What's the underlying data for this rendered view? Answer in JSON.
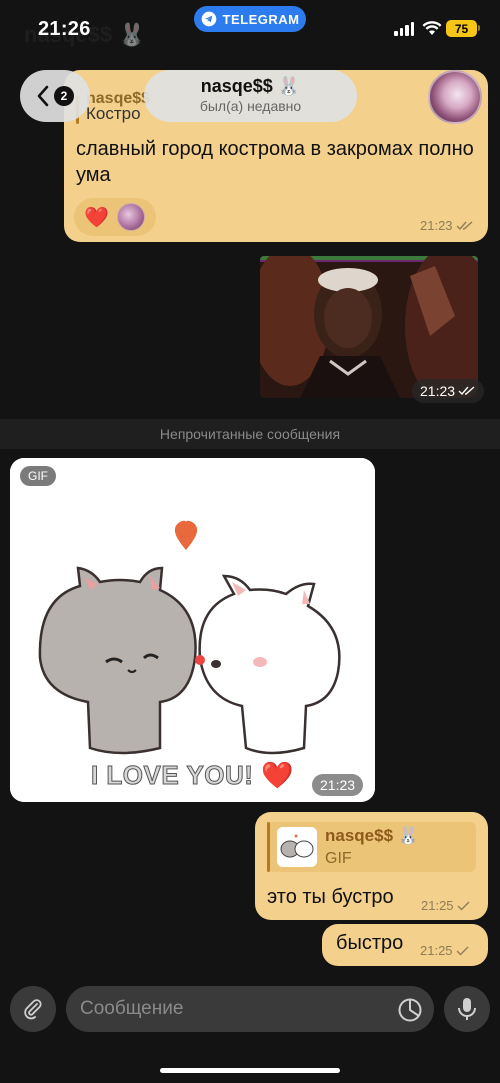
{
  "status_bar": {
    "time": "21:26",
    "app_pill": "TELEGRAM",
    "battery": "75"
  },
  "header": {
    "back_badge": "2",
    "contact_name": "nasqe$$ 🐰",
    "contact_status": "был(а) недавно"
  },
  "messages": {
    "top": {
      "reply_name": "nasqe$$",
      "reply_text": "Костро",
      "text": "славный город кострома в закромах полно ума",
      "reaction": "❤️",
      "time": "21:23"
    },
    "photo": {
      "time": "21:23"
    },
    "unread_divider": "Непрочитанные сообщения",
    "gif": {
      "tag": "GIF",
      "caption": "I LOVE YOU! ❤️",
      "time": "21:23"
    },
    "reply": {
      "quote_name": "nasqe$$ 🐰",
      "quote_type": "GIF",
      "text": "это ты бустро",
      "time": "21:25"
    },
    "short": {
      "text": "быстро",
      "time": "21:25"
    }
  },
  "input": {
    "placeholder": "Сообщение"
  },
  "colors": {
    "background": "#131313",
    "own_bubble": "#f3d08c",
    "telegram_blue": "#2c7cf0",
    "battery": "#f5c518"
  }
}
